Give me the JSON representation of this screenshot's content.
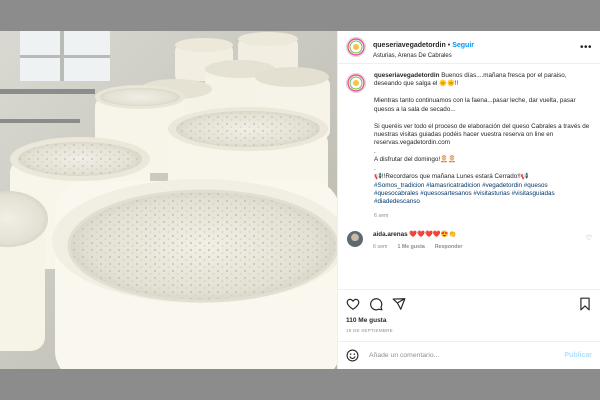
{
  "post": {
    "username": "queseriavegadetordin",
    "follow_label": "Seguir",
    "location": "Asturias, Arenas De Cabrales",
    "caption_user": "queseriavegadetordin",
    "caption_line1": "Buenos días....mañana fresca por el paraiso, deseando que salga el 🌞🌞!!",
    "caption_line2": "Mientras tanto continuamos con la faena...pasar leche, dar vuelta, pasar quesos a la sala de secado...",
    "caption_line3": "Si queréis ver todo el proceso de elaboración del queso Cabrales a través de nuestras visitas guiadas podéis hacer vuestra reserva on line en reservas.vegadetordin.com",
    "caption_dot1": ".",
    "caption_line4": "A disfrutar del domingo!🤶🤶",
    "caption_dot2": ".",
    "caption_line5": "📢!!Recordaros que mañana Lunes estará Cerrado!!📢",
    "hashtags": "#Somos_tradicion #lamasricatradicion #vegadetordin #quesos #quesocabrales #quesosartesanos #visitasturias #visitasguiadas #diadedescanso",
    "caption_time": "6 sem",
    "likes": "110 Me gusta",
    "date": "19 DE SEPTIEMBRE",
    "comment_placeholder": "Añade un comentario...",
    "post_button": "Publicar"
  },
  "reply": {
    "username": "aida.arenas",
    "text": "❤️❤️❤️❤️😍👏",
    "time": "6 sem",
    "likes": "1 Me gusta",
    "reply_label": "Responder"
  },
  "icons": {
    "like": "heart-icon",
    "comment": "comment-icon",
    "share": "share-icon",
    "save": "bookmark-icon",
    "emoji": "smile-icon",
    "options": "more-options-icon"
  },
  "colors": {
    "link": "#0095f6",
    "hashtag": "#00376b",
    "muted": "#8e8e8e",
    "post_disabled": "#b2dffc"
  }
}
